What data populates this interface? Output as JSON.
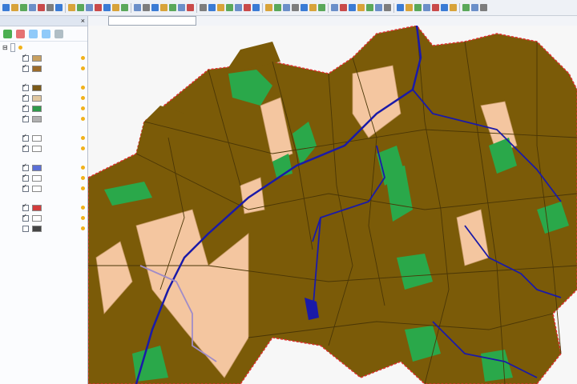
{
  "toolbar": {
    "buttons": [
      "#3a7bd5",
      "#d8a33a",
      "#5aa85a",
      "#6b8fc9",
      "#c94a4a",
      "#7d7d7d",
      "#3a7bd5",
      "#d8a33a",
      "#5aa85a",
      "#6b8fc9",
      "#c94a4a",
      "#3a7bd5",
      "#d8a33a",
      "#5aa85a",
      "#6b8fc9",
      "#7d7d7d",
      "#3a7bd5",
      "#d8a33a",
      "#5aa85a",
      "#6b8fc9",
      "#c94a4a",
      "#7d7d7d",
      "#3a7bd5",
      "#d8a33a",
      "#5aa85a",
      "#6b8fc9",
      "#c94a4a",
      "#3a7bd5",
      "#d8a33a",
      "#5aa85a",
      "#6b8fc9",
      "#7d7d7d",
      "#3a7bd5",
      "#d8a33a",
      "#5aa85a",
      "#6b8fc9",
      "#c94a4a",
      "#3a7bd5",
      "#d8a33a",
      "#5aa85a",
      "#6b8fc9",
      "#7d7d7d",
      "#3a7bd5",
      "#d8a33a",
      "#5aa85a",
      "#6b8fc9",
      "#c94a4a",
      "#3a7bd5",
      "#d8a33a",
      "#5aa85a",
      "#6b8fc9",
      "#7d7d7d"
    ]
  },
  "scale": {
    "value": ""
  },
  "panel": {
    "title": "",
    "close": "×",
    "root_label": "",
    "layers": [
      {
        "name": "",
        "checked": true,
        "sym": "#c8a060"
      },
      {
        "name": "",
        "checked": true,
        "sym": "#9c6b2a",
        "sub": ""
      },
      {
        "name": "",
        "checked": true,
        "sym": "#7a5a1a"
      },
      {
        "name": "",
        "checked": true,
        "sym": "#e0c7a0"
      },
      {
        "name": "",
        "checked": true,
        "sym": "#2e9a4a"
      },
      {
        "name": "",
        "checked": true,
        "sym": "#b0b0b0",
        "sub": ""
      },
      {
        "name": "",
        "checked": true,
        "sym": "#ffffff"
      },
      {
        "name": "",
        "checked": true,
        "sym": "#ffffff",
        "sub": ""
      },
      {
        "name": "",
        "checked": true,
        "sym": "#5b6fd6"
      },
      {
        "name": "",
        "checked": true,
        "sym": "#ffffff"
      },
      {
        "name": "",
        "checked": true,
        "sym": "#ffffff",
        "sub": ""
      },
      {
        "name": "",
        "checked": true,
        "sym": "#d23c3c"
      },
      {
        "name": "",
        "checked": true,
        "sym": "#ffffff"
      },
      {
        "name": "",
        "checked": false,
        "sym": "#444"
      }
    ]
  },
  "map": {
    "colors": {
      "forest": "#7b5b08",
      "forest_line": "#4a3606",
      "clearing": "#f4c6a0",
      "meadow": "#2aa84a",
      "water": "#1a1aa8",
      "boundary": "#e03030",
      "road": "#a08cc8",
      "background": "#f7f7f7"
    }
  }
}
